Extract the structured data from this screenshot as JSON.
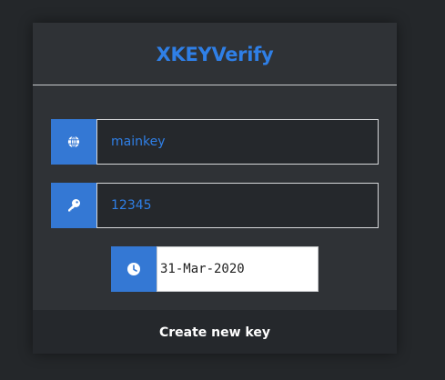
{
  "app": {
    "title": "XKEYVerify"
  },
  "form": {
    "name": {
      "icon": "globe-icon",
      "value": "mainkey"
    },
    "key": {
      "icon": "key-icon",
      "value": "12345"
    },
    "expiry": {
      "icon": "clock-icon",
      "value": "31-Mar-2020"
    },
    "submit_label": "Create new key"
  },
  "colors": {
    "accent": "#3478d4",
    "title_text": "#2f7fe6",
    "page_background": "#24272a",
    "card_background": "#2f3236",
    "input_background": "#25282c"
  }
}
